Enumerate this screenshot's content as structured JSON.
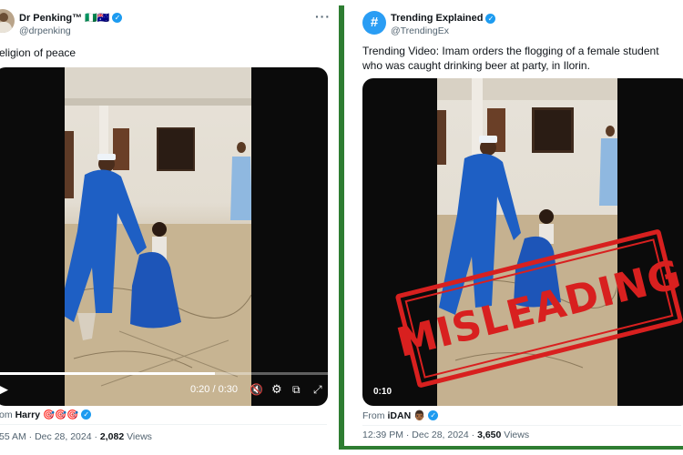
{
  "left_tweet": {
    "display_name": "Dr Penking™",
    "flags": "🇳🇬🇦🇺",
    "handle": "@drpenking",
    "text": "eligion of peace",
    "video": {
      "time": "0:20 / 0:30"
    },
    "from_prefix": "om",
    "from_user": "Harry",
    "from_emoji": "🎯🎯🎯",
    "timestamp": "55 AM · Dec 28, 2024 · ",
    "views_count": "2,082",
    "views_label": " Views"
  },
  "right_tweet": {
    "display_name": "Trending Explained",
    "handle": "@TrendingEx",
    "text": "Trending Video: Imam orders the flogging of a female student who was caught drinking beer at party, in Ilorin.",
    "video": {
      "time": "0:10"
    },
    "stamp": "MISLEADING",
    "from_prefix": "From ",
    "from_user": "iDAN",
    "from_emoji": "👨🏾",
    "timestamp": "12:39 PM · Dec 28, 2024 · ",
    "views_count": "3,650",
    "views_label": " Views"
  },
  "colors": {
    "verified": "#1d9bf0",
    "frame_green": "#2e7d32",
    "stamp_red": "#d8201f",
    "robe_blue": "#1e5fc4"
  }
}
